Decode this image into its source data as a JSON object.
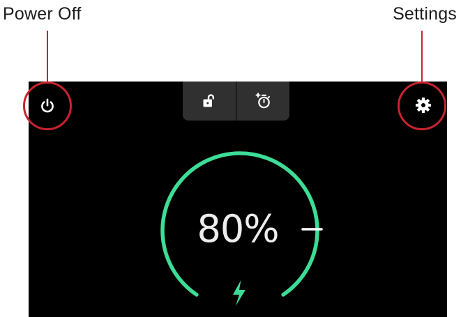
{
  "callouts": {
    "power_off": "Power Off",
    "settings": "Settings"
  },
  "colors": {
    "accent": "#3ddc97",
    "callout": "#c8232f",
    "screen_background": "#000000",
    "toolbar_background": "#303030",
    "icon": "#ffffff"
  },
  "icons": {
    "power": "power-icon",
    "settings": "gear-icon",
    "unlock": "unlock-icon",
    "timer": "add-timer-icon",
    "charging": "lightning-bolt-icon",
    "adjust": "slider-handle"
  },
  "battery": {
    "charge_label": "80%",
    "charge_level": 0.8,
    "charging": true
  }
}
